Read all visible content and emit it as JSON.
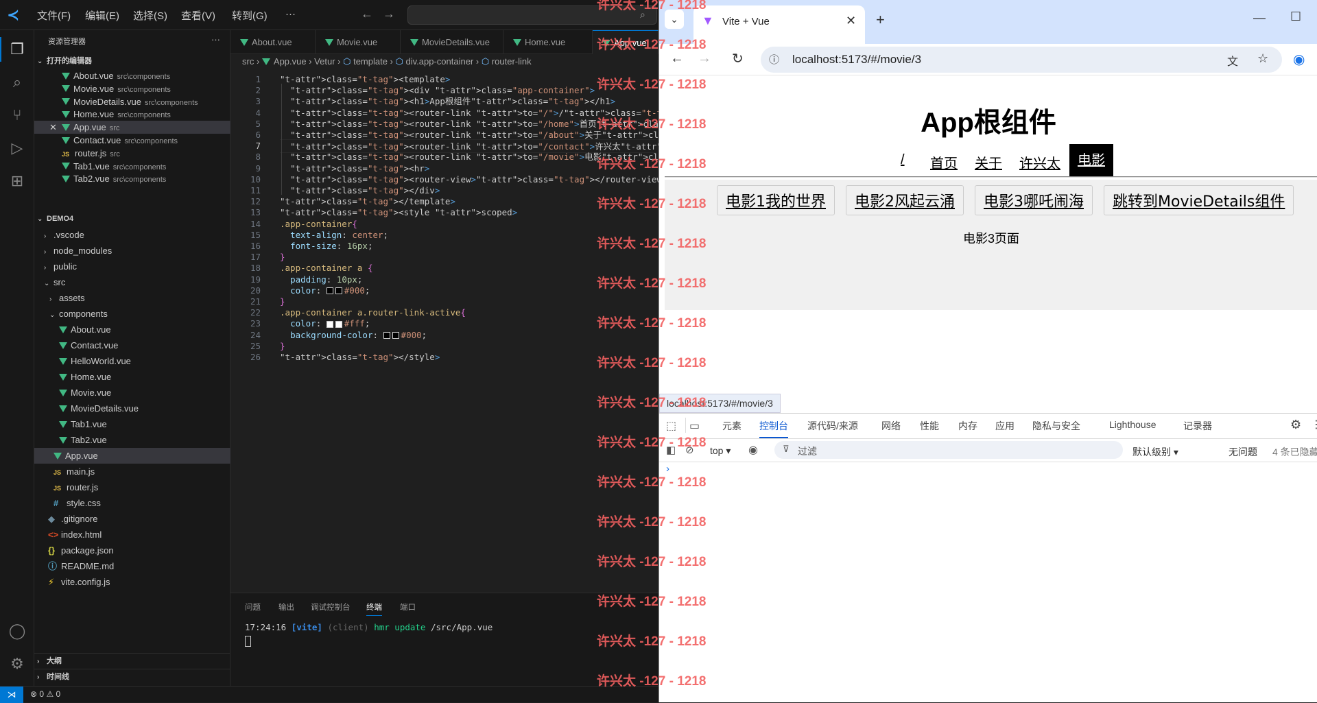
{
  "vscode": {
    "menu": [
      "文件(F)",
      "编辑(E)",
      "选择(S)",
      "查看(V)",
      "转到(G)",
      "···"
    ],
    "explorer_title": "资源管理器",
    "open_editors_title": "打开的编辑器",
    "open_editors": [
      {
        "name": "About.vue",
        "path": "src\\components",
        "icon": "vue-icon"
      },
      {
        "name": "Movie.vue",
        "path": "src\\components",
        "icon": "vue-icon"
      },
      {
        "name": "MovieDetails.vue",
        "path": "src\\components",
        "icon": "vue-icon"
      },
      {
        "name": "Home.vue",
        "path": "src\\components",
        "icon": "vue-icon"
      },
      {
        "name": "App.vue",
        "path": "src",
        "icon": "vue-icon",
        "active": true
      },
      {
        "name": "Contact.vue",
        "path": "src\\components",
        "icon": "vue-icon"
      },
      {
        "name": "router.js",
        "path": "src",
        "icon": "js-icon"
      },
      {
        "name": "Tab1.vue",
        "path": "src\\components",
        "icon": "vue-icon"
      },
      {
        "name": "Tab2.vue",
        "path": "src\\components",
        "icon": "vue-icon"
      }
    ],
    "project_title": "DEMO4",
    "tree": [
      {
        "name": ".vscode",
        "type": "folder",
        "depth": 0
      },
      {
        "name": "node_modules",
        "type": "folder",
        "depth": 0
      },
      {
        "name": "public",
        "type": "folder",
        "depth": 0
      },
      {
        "name": "src",
        "type": "folder-open",
        "depth": 0
      },
      {
        "name": "assets",
        "type": "folder",
        "depth": 1
      },
      {
        "name": "components",
        "type": "folder-open",
        "depth": 1
      },
      {
        "name": "About.vue",
        "type": "vue",
        "depth": 2
      },
      {
        "name": "Contact.vue",
        "type": "vue",
        "depth": 2
      },
      {
        "name": "HelloWorld.vue",
        "type": "vue",
        "depth": 2
      },
      {
        "name": "Home.vue",
        "type": "vue",
        "depth": 2
      },
      {
        "name": "Movie.vue",
        "type": "vue",
        "depth": 2
      },
      {
        "name": "MovieDetails.vue",
        "type": "vue",
        "depth": 2
      },
      {
        "name": "Tab1.vue",
        "type": "vue",
        "depth": 2
      },
      {
        "name": "Tab2.vue",
        "type": "vue",
        "depth": 2
      },
      {
        "name": "App.vue",
        "type": "vue",
        "depth": 1,
        "active": true
      },
      {
        "name": "main.js",
        "type": "js",
        "depth": 1
      },
      {
        "name": "router.js",
        "type": "js",
        "depth": 1
      },
      {
        "name": "style.css",
        "type": "css",
        "depth": 1
      },
      {
        "name": ".gitignore",
        "type": "git",
        "depth": 0
      },
      {
        "name": "index.html",
        "type": "html",
        "depth": 0
      },
      {
        "name": "package.json",
        "type": "json",
        "depth": 0
      },
      {
        "name": "README.md",
        "type": "md",
        "depth": 0
      },
      {
        "name": "vite.config.js",
        "type": "vite",
        "depth": 0
      }
    ],
    "outline_title": "大纲",
    "timeline_title": "时间线",
    "tabs": [
      "About.vue",
      "Movie.vue",
      "MovieDetails.vue",
      "Home.vue",
      "App.vue"
    ],
    "active_tab": "App.vue",
    "breadcrumb": [
      "src",
      "App.vue",
      "Vetur",
      "template",
      "div.app-container",
      "router-link"
    ],
    "code_lines": [
      "<template>",
      "  <div class=\"app-container\">",
      "  <h1>App根组件</h1>",
      "  <router-link to=\"/\">/</router-link>",
      "  <router-link to=\"/home\">首页</router-link>",
      "  <router-link to=\"/about\">关于</router-link>",
      "  <router-link to=\"/contact\">许兴太</router-link>",
      "  <router-link to=\"/movie\">电影</router-link>",
      "  <hr>",
      "  <router-view></router-view>",
      "  </div>",
      "</template>",
      "<style scoped>",
      ".app-container{",
      "  text-align: center;",
      "  font-size: 16px;",
      "}",
      ".app-container a {",
      "  padding: 10px;",
      "  color: #000;",
      "}",
      ".app-container a.router-link-active{",
      "  color: #fff;",
      "  background-color: #000;",
      "}",
      "</style>"
    ],
    "current_line": 7,
    "panel_tabs": [
      "问题",
      "输出",
      "调试控制台",
      "终端",
      "端口"
    ],
    "active_panel_tab": "终端",
    "terminal": {
      "time": "17:24:16",
      "tag": "[vite]",
      "client": "(client)",
      "msg": "hmr update",
      "file": "/src/App.vue"
    },
    "status": {
      "errors": "0",
      "warnings": "0"
    }
  },
  "chrome": {
    "tab_title": "Vite + Vue",
    "url": "localhost:5173/#/movie/3",
    "status_url": "localhost:5173/#/movie/3",
    "page": {
      "h1": "App根组件",
      "nav": [
        "/",
        "首页",
        "关于",
        "许兴太",
        "电影"
      ],
      "active_nav": "电影",
      "movie_links": [
        "电影1我的世界",
        "电影2风起云涌",
        "电影3哪吒闹海",
        "跳转到MovieDetails组件"
      ],
      "content": "电影3页面"
    },
    "devtools": {
      "tabs": [
        "元素",
        "控制台",
        "源代码/来源",
        "网络",
        "性能",
        "内存",
        "应用",
        "隐私与安全",
        "Lighthouse",
        "记录器"
      ],
      "active_tab": "控制台",
      "context": "top",
      "filter_placeholder": "过滤",
      "level": "默认级别",
      "issues": "无问题",
      "hidden": "4 条已隐藏"
    }
  },
  "watermark": "许兴太 -127 - 1218"
}
